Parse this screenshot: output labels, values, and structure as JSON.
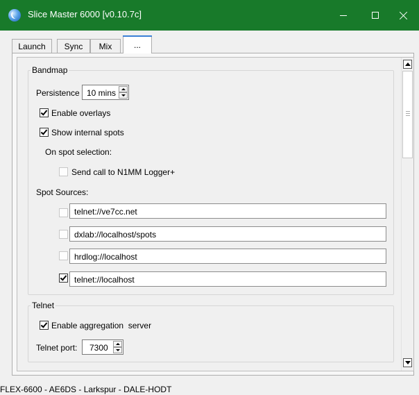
{
  "window": {
    "title": "Slice Master 6000 [v0.10.7c]"
  },
  "tabs": [
    {
      "label": "Launch"
    },
    {
      "label": "Sync"
    },
    {
      "label": "Mix"
    },
    {
      "label": "..."
    }
  ],
  "bandmap": {
    "group_title": "Bandmap",
    "persistence_label": "Persistence",
    "persistence_value": "10 mins",
    "enable_overlays": {
      "label": "Enable overlays",
      "checked": true
    },
    "show_internal_spots": {
      "label": "Show internal spots",
      "checked": true
    },
    "on_spot_selection_label": "On spot selection:",
    "send_call": {
      "label": "Send call to N1MM Logger+",
      "checked": false
    },
    "spot_sources_label": "Spot Sources:",
    "spot_sources": [
      {
        "value": "telnet://ve7cc.net",
        "checked": false
      },
      {
        "value": "dxlab://localhost/spots",
        "checked": false
      },
      {
        "value": "hrdlog://localhost",
        "checked": false
      },
      {
        "value": "telnet://localhost",
        "checked": true
      }
    ]
  },
  "telnet": {
    "group_title": "Telnet",
    "enable_aggregation": {
      "label": "Enable aggregation  server",
      "checked": true
    },
    "port_label": "Telnet port:",
    "port_value": "7300"
  },
  "status_bar": {
    "text": "FLEX-6600 - AE6DS - Larkspur - DALE-HODT"
  },
  "colors": {
    "titlebar": "#187a2a",
    "active_tab_accent": "#3b7fd6"
  }
}
